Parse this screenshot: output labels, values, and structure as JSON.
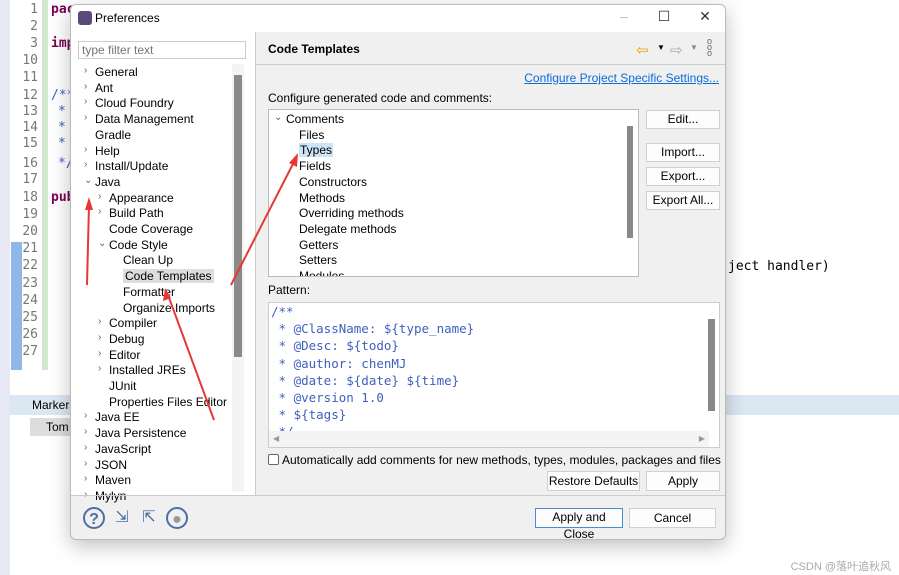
{
  "editor": {
    "line_numbers": [
      "1",
      "2",
      "3",
      "10",
      "11",
      "12",
      "13",
      "14",
      "15",
      "16",
      "17",
      "18",
      "19",
      "20",
      "21",
      "22",
      "23",
      "24",
      "25",
      "26",
      "27"
    ],
    "code_fragments": [
      "pac",
      "imp",
      "/**",
      "*",
      "*",
      "*",
      "*/",
      "pub"
    ],
    "right_code": "ject handler)"
  },
  "views": {
    "markers": "Markers",
    "server": "Tom"
  },
  "dialog": {
    "title": "Preferences",
    "filter_placeholder": "type filter text",
    "nav": [
      "General",
      "Ant",
      "Cloud Foundry",
      "Data Management",
      "Gradle",
      "Help",
      "Install/Update",
      "Java",
      "Appearance",
      "Build Path",
      "Code Coverage",
      "Code Style",
      "Clean Up",
      "Code Templates",
      "Formatter",
      "Organize Imports",
      "Compiler",
      "Debug",
      "Editor",
      "Installed JREs",
      "JUnit",
      "Properties Files Editor",
      "Java EE",
      "Java Persistence",
      "JavaScript",
      "JSON",
      "Maven",
      "Mylyn"
    ],
    "selected_nav": "Code Templates",
    "page_title": "Code Templates",
    "project_link": "Configure Project Specific Settings...",
    "configure_label": "Configure generated code and comments:",
    "templates": [
      "Comments",
      "Files",
      "Types",
      "Fields",
      "Constructors",
      "Methods",
      "Overriding methods",
      "Delegate methods",
      "Getters",
      "Setters",
      "Modules"
    ],
    "selected_template": "Types",
    "buttons": {
      "edit": "Edit...",
      "import": "Import...",
      "export": "Export...",
      "export_all": "Export All...",
      "restore": "Restore Defaults",
      "apply": "Apply",
      "apply_close": "Apply and Close",
      "cancel": "Cancel"
    },
    "pattern_label": "Pattern:",
    "pattern_lines": [
      "/**",
      " * @ClassName: ${type_name}",
      " * @Desc: ${todo}",
      " * @author: chenMJ",
      " * @date: ${date} ${time}",
      " * @version 1.0",
      " * ${tags}",
      " */"
    ],
    "auto_comment_label": "Automatically add comments for new methods, types, modules, packages and files",
    "auto_comment_checked": false
  },
  "watermark": "CSDN @落叶追秋风",
  "colors": {
    "link": "#0b6bd8",
    "comment": "#3f5fbf",
    "annotation_arrow": "#e53935"
  }
}
